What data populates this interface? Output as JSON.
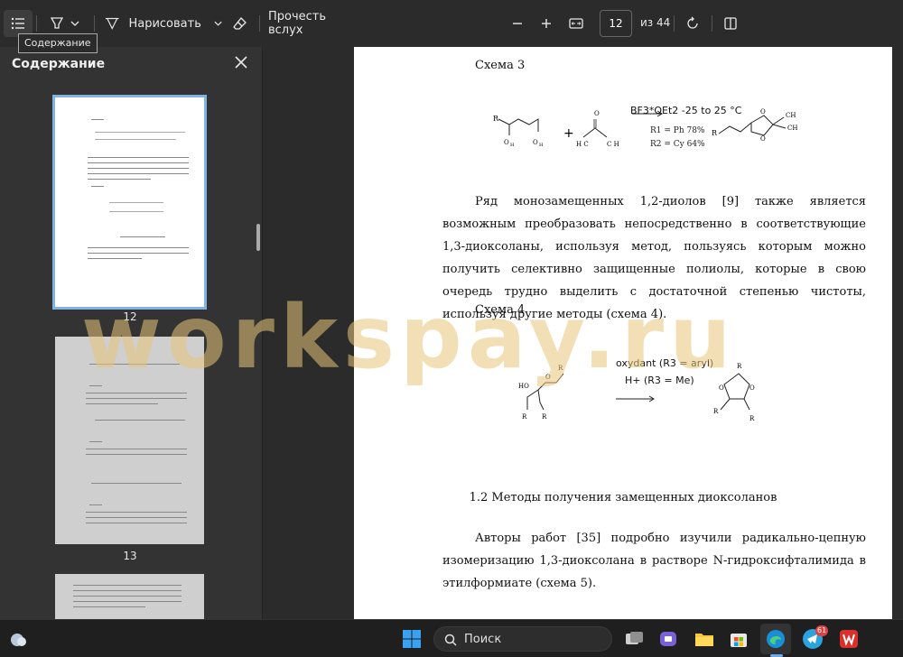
{
  "toolbar": {
    "draw_label": "Нарисовать",
    "read_aloud_label": "Прочесть вслух",
    "page_number": "12",
    "page_total": "из 44",
    "tooltip": "Содержание"
  },
  "sidebar": {
    "title": "Содержание",
    "thumbnails": [
      {
        "label": "12",
        "selected": true
      },
      {
        "label": "13",
        "selected": false
      }
    ]
  },
  "document": {
    "scheme3_title": "Схема 3",
    "scheme3_conditions": {
      "line1": "BF3*OEt2 -25 to 25 °C",
      "line2": "R1 = Ph 78%",
      "line3": "R2 = Cy 64%"
    },
    "paragraph1": "Ряд монозамещенных 1,2-диолов [9] также является возможным преобразовать непосредственно в соответствующие 1,3-диоксоланы, используя метод, пользуясь которым можно получить селективно защищенные полиолы, которые в свою очередь трудно выделить с достаточной степенью чистоты, используя другие методы (схема 4).",
    "scheme4_title": "Схема 4",
    "scheme4_conditions": {
      "line1": "oxydant (R3 = aryl)",
      "line2": "H+ (R3 = Me)"
    },
    "section_heading": "1.2 Методы получения замещенных диоксоланов",
    "paragraph2": "Авторы работ [35] подробно изучили радикально-цепную изомеризацию 1,3-диоксолана в растворе N-гидроксифталимида в этилформиате (схема 5)."
  },
  "watermark": "workspay.ru",
  "taskbar": {
    "search_label": "Поиск",
    "telegram_badge": "61"
  },
  "colors": {
    "toolbar_bg": "#2b2b2b",
    "sidebar_bg": "#333333",
    "page_bg": "#ffffff",
    "selection_border": "#7fb3e6",
    "watermark": "#e8c478"
  }
}
